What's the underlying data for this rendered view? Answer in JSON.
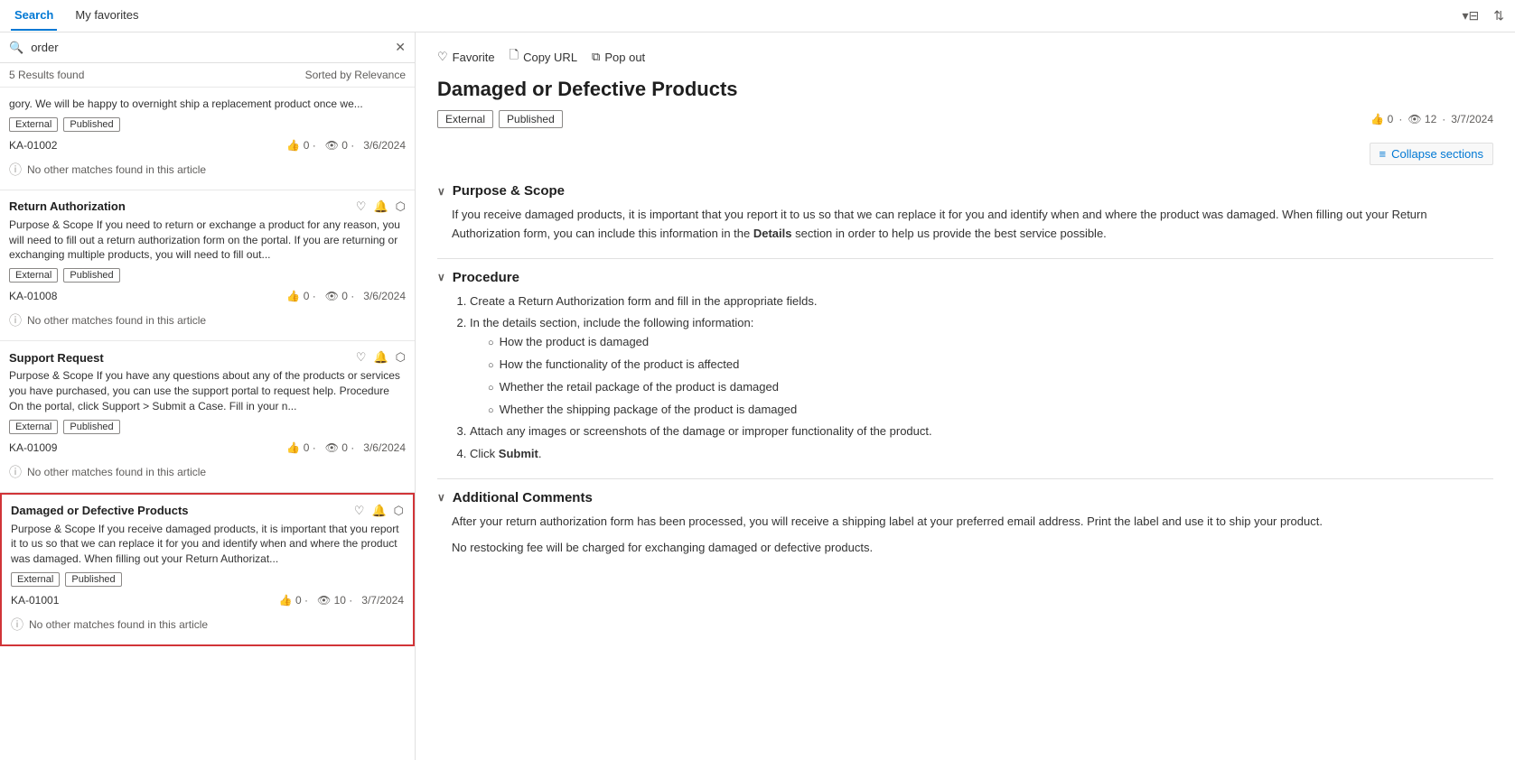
{
  "tabs": {
    "search": "Search",
    "favorites": "My favorites"
  },
  "header_icons": {
    "filter": "⊞",
    "sort": "↕"
  },
  "search": {
    "placeholder": "order",
    "value": "order"
  },
  "results_info": {
    "count": "5 Results found",
    "sort": "Sorted by Relevance"
  },
  "article_actions": {
    "favorite": "Favorite",
    "copy_url": "Copy URL",
    "pop_out": "Pop out"
  },
  "results": [
    {
      "id": "first",
      "title": "",
      "excerpt": "gory. We will be happy to overnight ship a replacement product once we...",
      "tags": [
        "External",
        "Published"
      ],
      "ka_id": "KA-01002",
      "likes": "0",
      "views": "0",
      "date": "3/6/2024",
      "no_match": "No other matches found in this article",
      "selected": false
    },
    {
      "id": "return-auth",
      "title": "Return Authorization",
      "excerpt": "Purpose & Scope If you need to return or exchange a product for any reason, you will need to fill out a return authorization form on the portal. If you are returning or exchanging multiple products, you will need to fill out...",
      "tags": [
        "External",
        "Published"
      ],
      "ka_id": "KA-01008",
      "likes": "0",
      "views": "0",
      "date": "3/6/2024",
      "no_match": "No other matches found in this article",
      "selected": false
    },
    {
      "id": "support-request",
      "title": "Support Request",
      "excerpt": "Purpose & Scope If you have any questions about any of the products or services you have purchased, you can use the support portal to request help. Procedure On the portal, click Support > Submit a Case. Fill in your n...",
      "tags": [
        "External",
        "Published"
      ],
      "ka_id": "KA-01009",
      "likes": "0",
      "views": "0",
      "date": "3/6/2024",
      "no_match": "No other matches found in this article",
      "selected": false
    },
    {
      "id": "damaged-defective",
      "title": "Damaged or Defective Products",
      "excerpt": "Purpose & Scope If you receive damaged products, it is important that you report it to us so that we can replace it for you and identify when and where the product was damaged. When filling out your Return Authorizat...",
      "tags": [
        "External",
        "Published"
      ],
      "ka_id": "KA-01001",
      "likes": "0",
      "views": "10",
      "date": "3/7/2024",
      "no_match": "No other matches found in this article",
      "selected": true
    }
  ],
  "article": {
    "title": "Damaged or Defective Products",
    "tags": [
      "External",
      "Published"
    ],
    "likes": "0",
    "views": "12",
    "date": "3/7/2024",
    "collapse_label": "Collapse sections",
    "sections": [
      {
        "id": "purpose-scope",
        "title": "Purpose & Scope",
        "content_type": "paragraph",
        "content": "If you receive damaged products, it is important that you report it to us so that we can replace it for you and identify when and where the product was damaged. When filling out your Return Authorization form, you can include this information in the Details section in order to help us provide the best service possible."
      },
      {
        "id": "procedure",
        "title": "Procedure",
        "content_type": "list",
        "steps": [
          {
            "text": "Create a Return Authorization form and fill in the appropriate fields.",
            "sub": []
          },
          {
            "text": "In the details section, include the following information:",
            "sub": [
              "How the product is damaged",
              "How the functionality of the product is affected",
              "Whether the retail package of the product is damaged",
              "Whether the shipping package of the product is damaged"
            ]
          },
          {
            "text": "Attach any images or screenshots of the damage or improper functionality of the product.",
            "sub": []
          },
          {
            "text": "Click Submit.",
            "sub": [],
            "bold_word": "Submit"
          }
        ]
      },
      {
        "id": "additional-comments",
        "title": "Additional Comments",
        "content_type": "paragraphs",
        "paragraphs": [
          "After your return authorization form has been processed, you will receive a shipping label at your preferred email address. Print the label and use it to ship your product.",
          "No restocking fee will be charged for exchanging damaged or defective products."
        ]
      }
    ]
  }
}
